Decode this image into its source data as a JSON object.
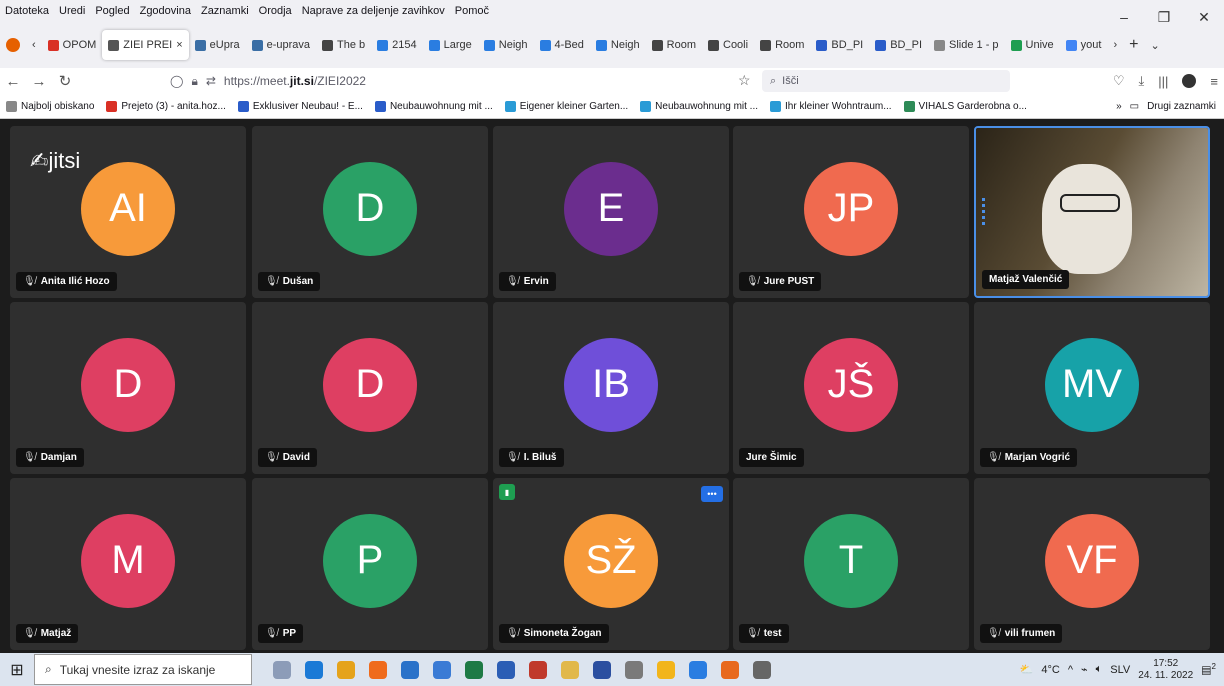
{
  "menu": [
    "Datoteka",
    "Uredi",
    "Pogled",
    "Zgodovina",
    "Zaznamki",
    "Orodja",
    "Naprave za deljenje zavihkov",
    "Pomoč"
  ],
  "window_controls": [
    "–",
    "❐",
    "✕"
  ],
  "tabs": [
    {
      "label": "OPOM",
      "color": "#d93025"
    },
    {
      "label": "ZIEI PREI",
      "color": "#555555",
      "active": true
    },
    {
      "label": "eUpra",
      "color": "#3a6ea5"
    },
    {
      "label": "e-uprava",
      "color": "#3a6ea5"
    },
    {
      "label": "The b",
      "color": "#444444"
    },
    {
      "label": "2154",
      "color": "#2a7de1"
    },
    {
      "label": "Large",
      "color": "#2a7de1"
    },
    {
      "label": "Neigh",
      "color": "#2a7de1"
    },
    {
      "label": "4-Bed",
      "color": "#2a7de1"
    },
    {
      "label": "Neigh",
      "color": "#2a7de1"
    },
    {
      "label": "Room",
      "color": "#444444"
    },
    {
      "label": "Cooli",
      "color": "#444444"
    },
    {
      "label": "Room",
      "color": "#444444"
    },
    {
      "label": "BD_PI",
      "color": "#2a5cc9"
    },
    {
      "label": "BD_PI",
      "color": "#2a5cc9"
    },
    {
      "label": "Slide 1 - p",
      "color": "#888888"
    },
    {
      "label": "Unive",
      "color": "#1e9e51"
    },
    {
      "label": "yout",
      "color": "#4285f4"
    }
  ],
  "nav": {
    "url_prefix": "https://meet.",
    "url_domain": "jit.si",
    "url_path": "/ZIEI2022",
    "search_placeholder": "Išči"
  },
  "bookmarks": [
    {
      "label": "Najbolj obiskano",
      "color": "#888888"
    },
    {
      "label": "Prejeto (3) - anita.hoz...",
      "color": "#d93025"
    },
    {
      "label": "Exklusiver Neubau! - E...",
      "color": "#2a5cc9"
    },
    {
      "label": "Neubauwohnung mit ...",
      "color": "#2a5cc9"
    },
    {
      "label": "Eigener kleiner Garten...",
      "color": "#2a9bd6"
    },
    {
      "label": "Neubauwohnung mit ...",
      "color": "#2a9bd6"
    },
    {
      "label": "Ihr kleiner Wohntraum...",
      "color": "#2a9bd6"
    },
    {
      "label": "VIHALS Garderobna o...",
      "color": "#2e8b57"
    }
  ],
  "bookmarks_more": "Drugi zaznamki",
  "app": {
    "logo": "jitsi"
  },
  "participants": [
    {
      "initials": "AI",
      "name": "Anita Ilić Hozo",
      "color": "#f79a3a",
      "muted": true
    },
    {
      "initials": "D",
      "name": "Dušan",
      "color": "#2aa166",
      "muted": true
    },
    {
      "initials": "E",
      "name": "Ervin",
      "color": "#6b2d8e",
      "muted": true
    },
    {
      "initials": "JP",
      "name": "Jure PUST",
      "color": "#f06a4f",
      "muted": true
    },
    {
      "initials": "",
      "name": "Matjaž Valenčić",
      "color": "",
      "muted": false,
      "video": true
    },
    {
      "initials": "D",
      "name": "Damjan",
      "color": "#de3f62",
      "muted": true
    },
    {
      "initials": "D",
      "name": "David",
      "color": "#de3f62",
      "muted": true
    },
    {
      "initials": "IB",
      "name": "I. Biluš",
      "color": "#6f4fd9",
      "muted": true
    },
    {
      "initials": "JŠ",
      "name": "Jure Šimic",
      "color": "#de3f62",
      "muted": false
    },
    {
      "initials": "MV",
      "name": "Marjan Vogrić",
      "color": "#17a2a8",
      "muted": true
    },
    {
      "initials": "M",
      "name": "Matjaž",
      "color": "#de3f62",
      "muted": true
    },
    {
      "initials": "P",
      "name": "PP",
      "color": "#2aa166",
      "muted": true
    },
    {
      "initials": "SŽ",
      "name": "Simoneta Žogan",
      "color": "#f79a3a",
      "muted": true
    },
    {
      "initials": "T",
      "name": "test",
      "color": "#2aa166",
      "muted": true
    },
    {
      "initials": "VF",
      "name": "vili frumen",
      "color": "#f06a4f",
      "muted": true
    }
  ],
  "taskbar": {
    "search_placeholder": "Tukaj vnesite izraz za iskanje",
    "apps": [
      "#8c9cb8",
      "#1b7ad6",
      "#e5a31b",
      "#ef6b1c",
      "#2a72c9",
      "#3a7bd5",
      "#1d7a45",
      "#2b5eb5",
      "#c0392b",
      "#e1b84a",
      "#2b4fa0",
      "#7a7a7a",
      "#f2b51b",
      "#2a7de1",
      "#e8691d",
      "#666666"
    ],
    "weather": "4°C",
    "language": "SLV",
    "time": "17:52",
    "date": "24. 11. 2022",
    "notifications": "2"
  }
}
